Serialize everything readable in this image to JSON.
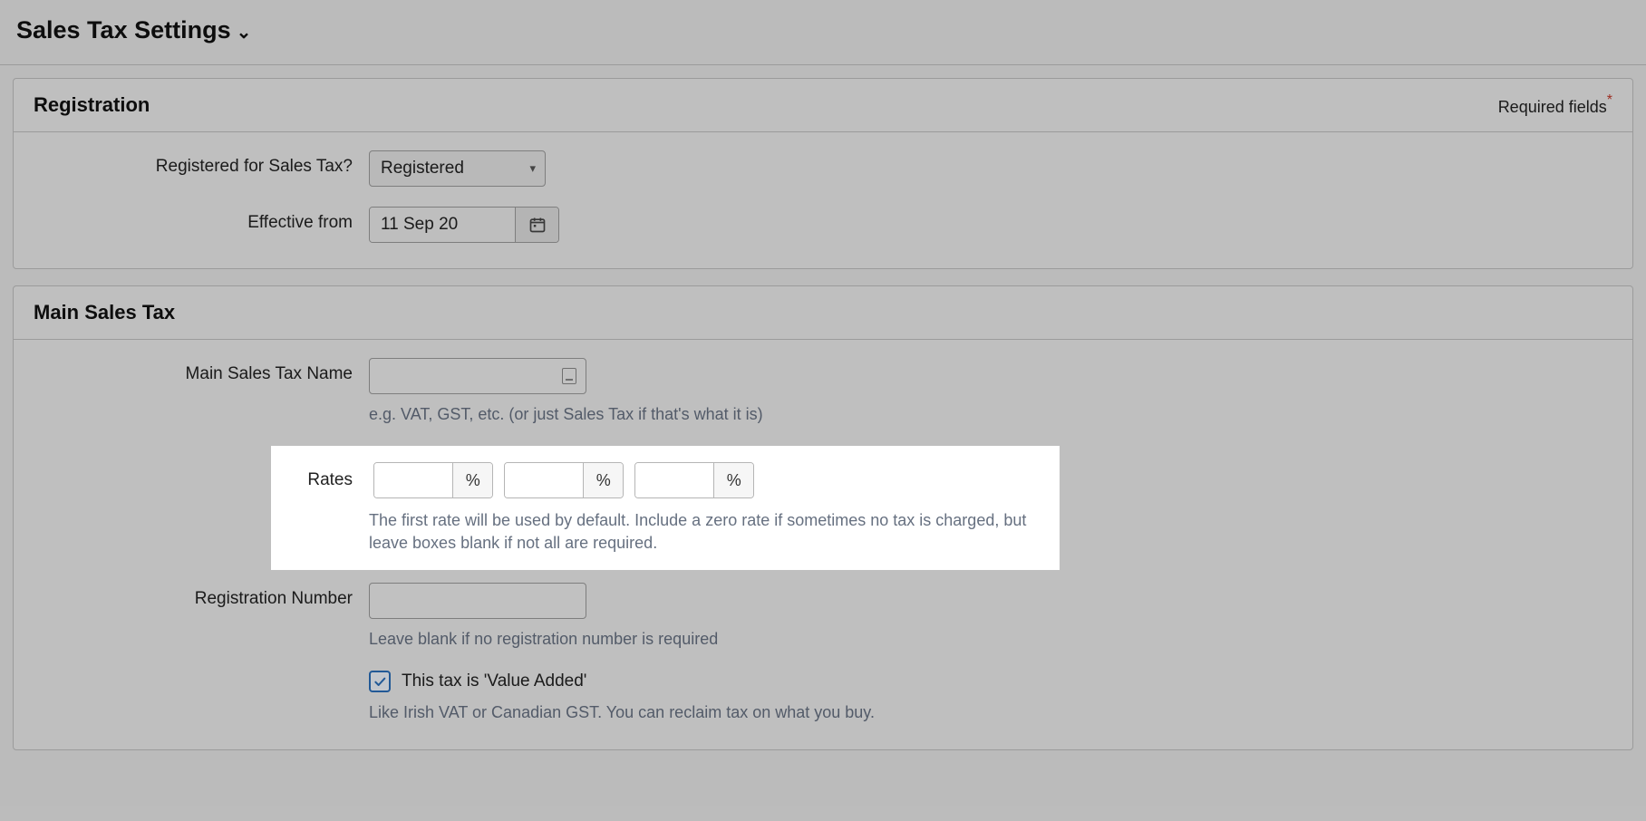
{
  "page": {
    "title": "Sales Tax Settings"
  },
  "required_note": "Required fields",
  "registration": {
    "title": "Registration",
    "registered_label": "Registered for Sales Tax?",
    "registered_value": "Registered",
    "effective_label": "Effective from",
    "effective_value": "11 Sep 20"
  },
  "main_tax": {
    "title": "Main Sales Tax",
    "name_label": "Main Sales Tax Name",
    "name_value": "",
    "name_help": "e.g. VAT, GST, etc. (or just Sales Tax if that's what it is)",
    "rates_label": "Rates",
    "rate_values": [
      "",
      "",
      ""
    ],
    "pct_symbol": "%",
    "rates_help": "The first rate will be used by default. Include a zero rate if sometimes no tax is charged, but leave boxes blank if not all are required.",
    "regnum_label": "Registration Number",
    "regnum_value": "",
    "regnum_help": "Leave blank if no registration number is required",
    "value_added_checked": true,
    "value_added_label": "This tax is 'Value Added'",
    "value_added_help": "Like Irish VAT or Canadian GST. You can reclaim tax on what you buy."
  }
}
